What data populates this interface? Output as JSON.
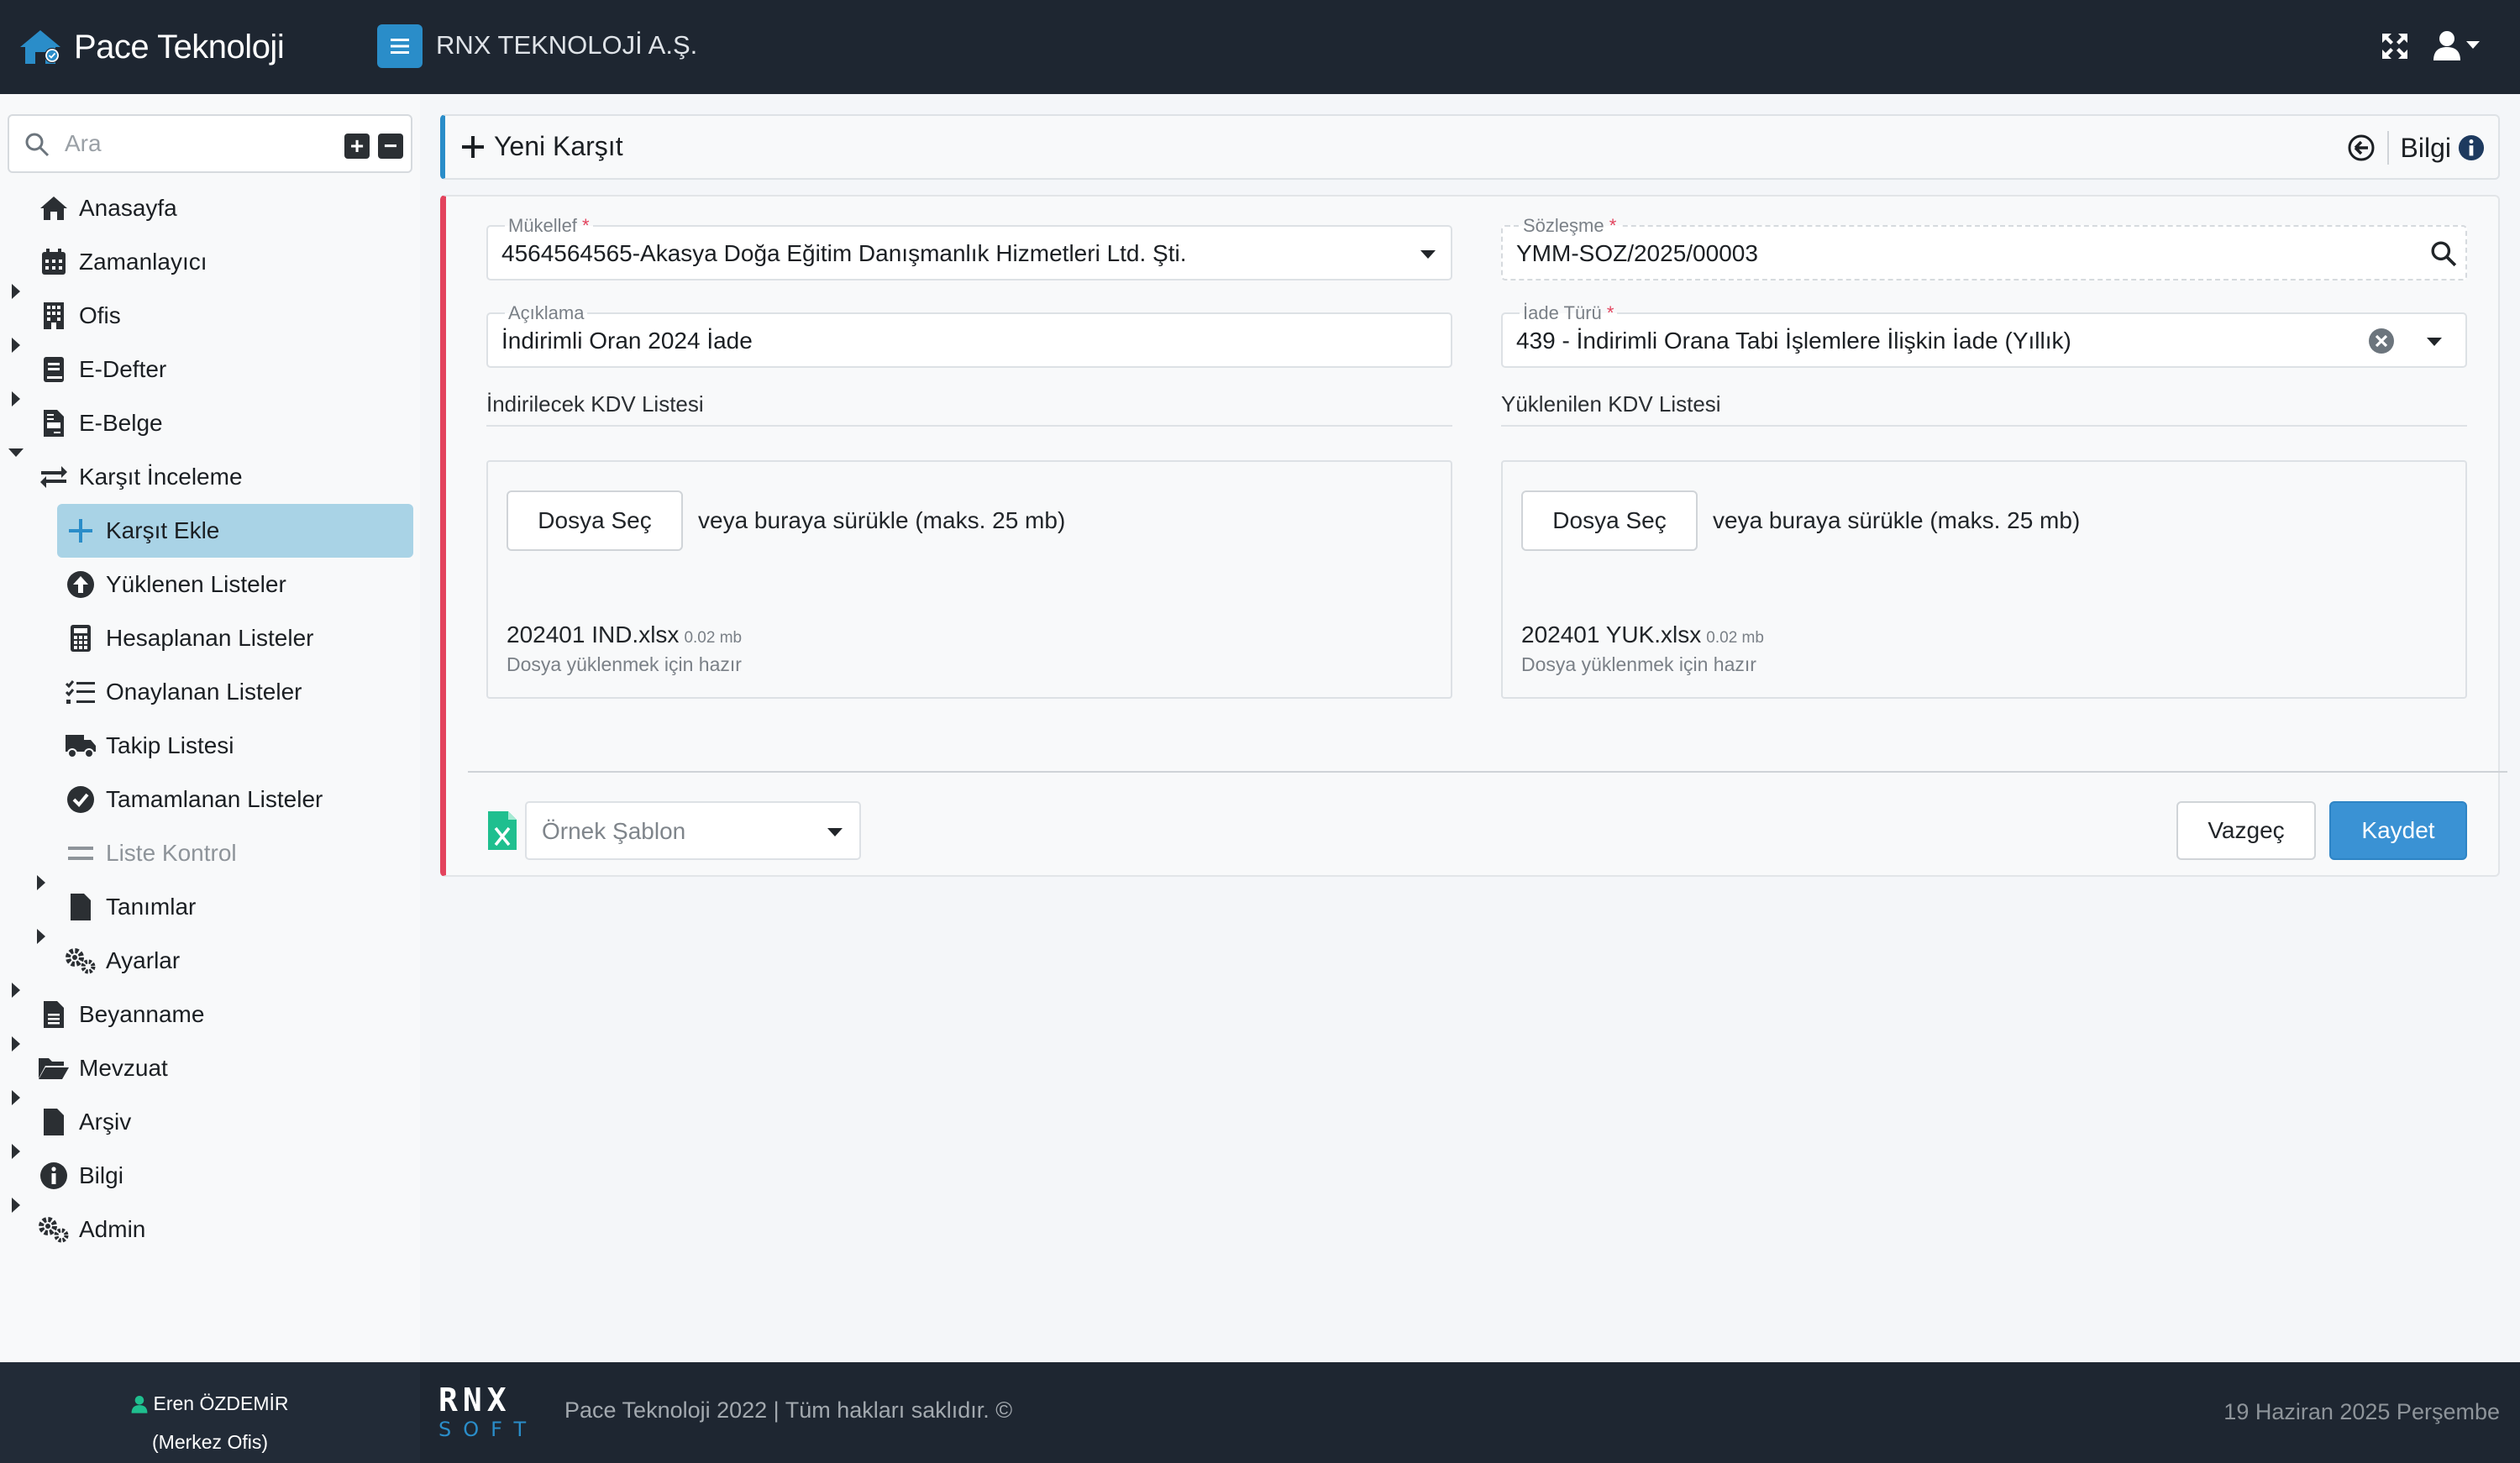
{
  "header": {
    "brand": "Pace Teknoloji",
    "company": "RNX TEKNOLOJİ A.Ş."
  },
  "sidebar": {
    "search_placeholder": "Ara",
    "items": [
      {
        "label": "Anasayfa",
        "icon": "home-icon"
      },
      {
        "label": "Zamanlayıcı",
        "icon": "calendar-icon"
      },
      {
        "label": "Ofis",
        "icon": "building-icon"
      },
      {
        "label": "E-Defter",
        "icon": "book-icon"
      },
      {
        "label": "E-Belge",
        "icon": "file-invoice-icon"
      },
      {
        "label": "Karşıt İnceleme",
        "icon": "exchange-icon"
      },
      {
        "label": "Karşıt Ekle",
        "icon": "plus-icon"
      },
      {
        "label": "Yüklenen Listeler",
        "icon": "upload-circle-icon"
      },
      {
        "label": "Hesaplanan Listeler",
        "icon": "calculator-icon"
      },
      {
        "label": "Onaylanan Listeler",
        "icon": "checklist-icon"
      },
      {
        "label": "Takip Listesi",
        "icon": "truck-icon"
      },
      {
        "label": "Tamamlanan Listeler",
        "icon": "check-circle-icon"
      },
      {
        "label": "Liste Kontrol",
        "icon": "equals-icon"
      },
      {
        "label": "Tanımlar",
        "icon": "file-icon"
      },
      {
        "label": "Ayarlar",
        "icon": "cogs-icon"
      },
      {
        "label": "Beyanname",
        "icon": "file-text-icon"
      },
      {
        "label": "Mevzuat",
        "icon": "folder-open-icon"
      },
      {
        "label": "Arşiv",
        "icon": "file-icon"
      },
      {
        "label": "Bilgi",
        "icon": "info-circle-icon"
      },
      {
        "label": "Admin",
        "icon": "cogs-icon"
      }
    ]
  },
  "page": {
    "title": "Yeni Karşıt",
    "info_label": "Bilgi"
  },
  "form": {
    "mukellef": {
      "label": "Mükellef",
      "value": "4564564565-Akasya Doğa Eğitim Danışmanlık Hizmetleri Ltd. Şti."
    },
    "sozlesme": {
      "label": "Sözleşme",
      "value": "YMM-SOZ/2025/00003"
    },
    "aciklama": {
      "label": "Açıklama",
      "value": "İndirimli Oran 2024 İade"
    },
    "iade_turu": {
      "label": "İade Türü",
      "value": "439 - İndirimli Orana Tabi İşlemlere İlişkin İade (Yıllık)"
    },
    "required_mark": "*",
    "left_list": {
      "title": "İndirilecek KDV Listesi",
      "button": "Dosya Seç",
      "hint": "veya buraya sürükle (maks. 25 mb)",
      "file_name": "202401 IND.xlsx",
      "file_size": "0.02 mb",
      "status": "Dosya yüklenmek için hazır"
    },
    "right_list": {
      "title": "Yüklenilen KDV Listesi",
      "button": "Dosya Seç",
      "hint": "veya buraya sürükle (maks. 25 mb)",
      "file_name": "202401 YUK.xlsx",
      "file_size": "0.02 mb",
      "status": "Dosya yüklenmek için hazır"
    },
    "template_placeholder": "Örnek Şablon",
    "cancel_label": "Vazgeç",
    "save_label": "Kaydet"
  },
  "footer": {
    "user": "Eren ÖZDEMİR",
    "office": "(Merkez Ofis)",
    "logo_top": "RNX",
    "logo_bottom": "SOFT",
    "copyright": "Pace Teknoloji 2022 | Tüm hakları saklıdır. ©",
    "date": "19 Haziran 2025 Perşembe"
  },
  "colors": {
    "accent": "#2a8dc9",
    "required": "#e3435d",
    "active_item": "#a9d3e6",
    "save_button": "#3a92d4",
    "topbar": "#1e2631"
  }
}
